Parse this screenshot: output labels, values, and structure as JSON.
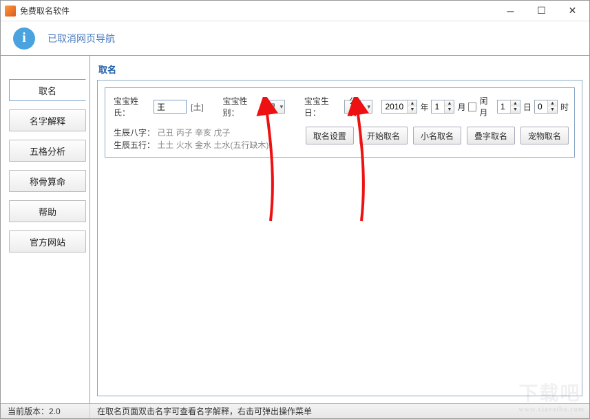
{
  "window": {
    "title": "免费取名软件"
  },
  "header": {
    "notice": "已取消网页导航"
  },
  "sidebar": {
    "items": [
      {
        "label": "取名"
      },
      {
        "label": "名字解释"
      },
      {
        "label": "五格分析"
      },
      {
        "label": "称骨算命"
      },
      {
        "label": "帮助"
      },
      {
        "label": "官方网站"
      }
    ]
  },
  "panel": {
    "title": "取名",
    "form": {
      "surname_label": "宝宝姓氏：",
      "surname_value": "王",
      "surname_tag": "[土]",
      "gender_label": "宝宝性别：",
      "gender_value": "男",
      "birth_label": "宝宝生日：",
      "calendar_value": "公历",
      "year_value": "2010",
      "year_suffix": "年",
      "month_value": "1",
      "month_suffix": "月",
      "leap_label": "闰月",
      "day_value": "1",
      "day_suffix": "日",
      "hour_value": "0",
      "hour_suffix": "时"
    },
    "info": {
      "bazi_label": "生辰八字：",
      "bazi_value": "己丑 丙子 辛亥 戊子",
      "wuxing_label": "生辰五行：",
      "wuxing_value": "土土 火水 金水 土水(五行缺木)"
    },
    "buttons": {
      "settings": "取名设置",
      "start": "开始取名",
      "nickname": "小名取名",
      "stacked": "叠字取名",
      "pet": "宠物取名"
    }
  },
  "status": {
    "version_label": "当前版本：2.0",
    "hint": "在取名页面双击名字可查看名字解释，右击可弹出操作菜单"
  },
  "watermark": {
    "text": "下载吧",
    "sub": "www.xiazaiba.com"
  }
}
